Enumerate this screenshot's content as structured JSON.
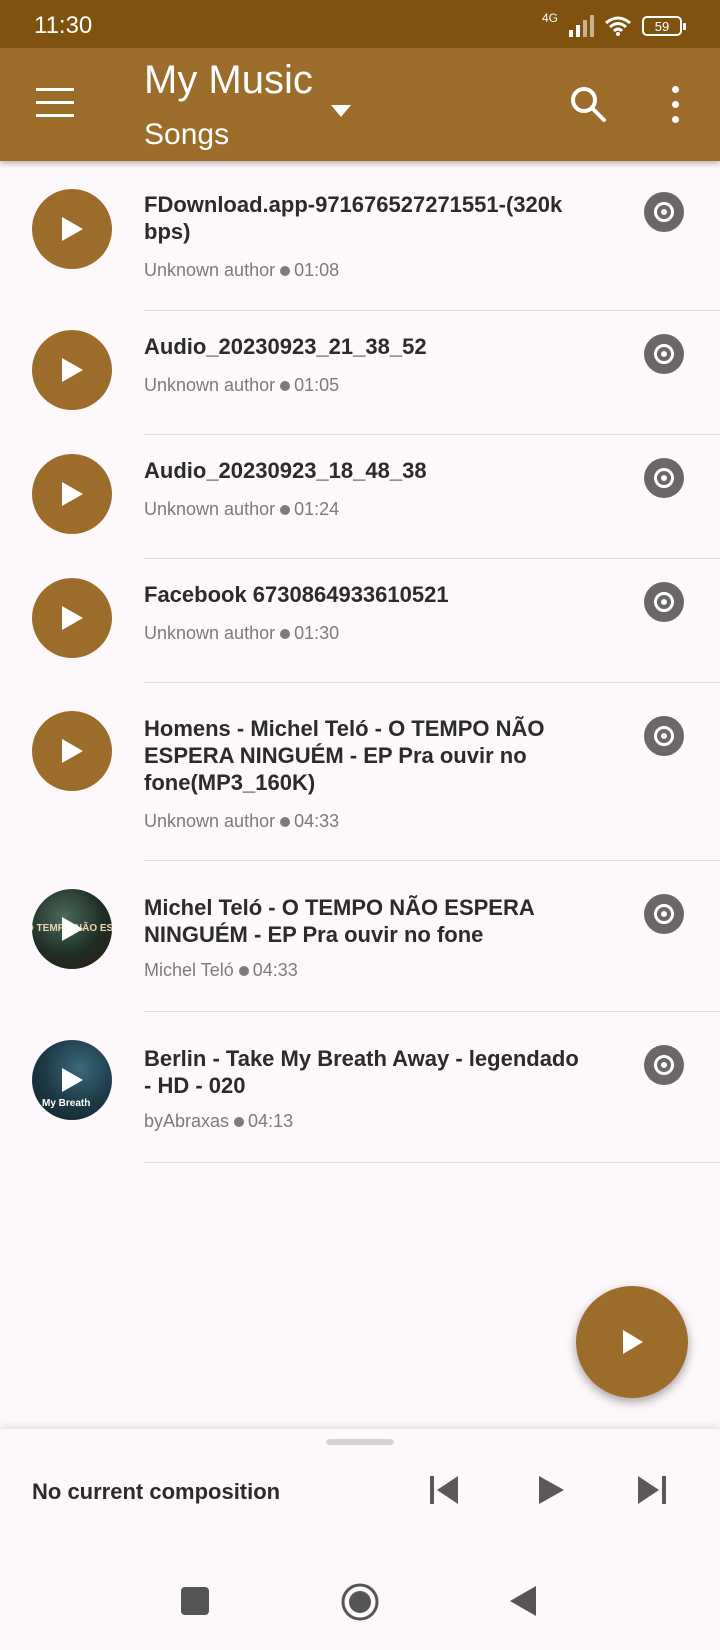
{
  "status_bar": {
    "time": "11:30",
    "network": "4G",
    "battery": "59"
  },
  "app_bar": {
    "title": "My Music",
    "subtitle": "Songs",
    "icons": [
      "menu-icon",
      "dropdown-icon",
      "search-icon",
      "more-vert-icon"
    ]
  },
  "songs": [
    {
      "name": "FDownload.app-971676527271551-(320k bps)",
      "author": "Unknown author",
      "duration": "01:08"
    },
    {
      "name": "Audio_20230923_21_38_52",
      "author": "Unknown author",
      "duration": "01:05"
    },
    {
      "name": "Audio_20230923_18_48_38",
      "author": "Unknown author",
      "duration": "01:24"
    },
    {
      "name": "Facebook 6730864933610521",
      "author": "Unknown author",
      "duration": "01:30"
    },
    {
      "name": "Homens - Michel Teló - O TEMPO NÃO ESPERA NINGUÉM -  EP Pra ouvir no fone(MP3_160K)",
      "author": "Unknown author",
      "duration": "04:33"
    },
    {
      "name": "Michel Teló - O TEMPO NÃO ESPERA NINGUÉM -  EP Pra ouvir no fone",
      "author": "Michel Teló",
      "duration": "04:33",
      "thumb_text": "O TEMPO NÃO ESPERA NINGUÉM"
    },
    {
      "name": "Berlin - Take My Breath Away - legendado - HD - 020",
      "author": "byAbraxas",
      "duration": "04:13",
      "thumb_text": "My Breath"
    }
  ],
  "player": {
    "now_playing": "No current composition"
  },
  "colors": {
    "primary": "#9c6c2a",
    "status_bar": "#7f5210",
    "background": "#fdf8fb"
  }
}
